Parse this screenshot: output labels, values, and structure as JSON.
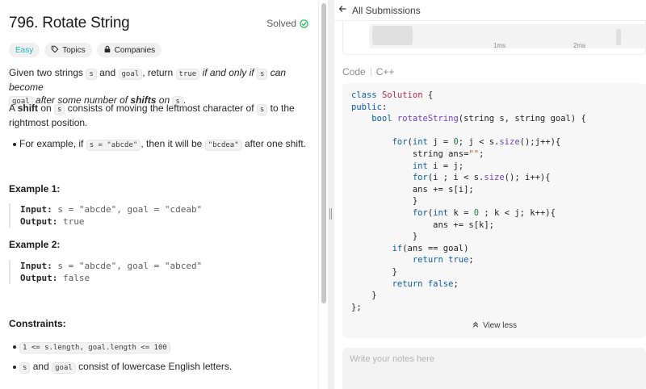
{
  "problem": {
    "title": "796. Rotate String",
    "status": "Solved",
    "badges": {
      "difficulty": "Easy",
      "topics": "Topics",
      "companies": "Companies"
    },
    "desc1": {
      "a": "Given two strings ",
      "s": "s",
      "b": " and ",
      "goal": "goal",
      "c": ", return ",
      "true": "true",
      "d": " if and only if ",
      "s2": "s",
      "e": " can become ",
      "goal2": "goal",
      "f": " after some number of ",
      "shifts": "shifts",
      "g": " on ",
      "s3": "s",
      "h": "."
    },
    "desc2": {
      "a": "A ",
      "shift": "shift",
      "b": " on ",
      "s": "s",
      "c": " consists of moving the leftmost character of ",
      "s2": "s",
      "d": " to the rightmost position."
    },
    "bullet1": {
      "a": "For example, if ",
      "code1": "s = \"abcde\"",
      "b": ", then it will be ",
      "code2": "\"bcdea\"",
      "c": " after one shift."
    },
    "example1": {
      "heading": "Example 1:",
      "input_label": "Input:",
      "input_value": "s = \"abcde\", goal = \"cdeab\"",
      "output_label": "Output:",
      "output_value": "true"
    },
    "example2": {
      "heading": "Example 2:",
      "input_label": "Input:",
      "input_value": "s = \"abcde\", goal = \"abced\"",
      "output_label": "Output:",
      "output_value": "false"
    },
    "constraints": {
      "heading": "Constraints:",
      "item1_code": "1 <= s.length, goal.length <= 100",
      "item2": {
        "s": "s",
        "a": " and ",
        "goal": "goal",
        "b": " consist of lowercase English letters."
      }
    }
  },
  "submission": {
    "back_label": "All Submissions",
    "chart_ticks": [
      "1ms",
      "2ms"
    ],
    "code_label": "Code",
    "language": "C++",
    "view_less": "View less",
    "notes_placeholder": "Write your notes here"
  },
  "icons": {
    "solved": "check-circle-icon",
    "topics": "tag-icon",
    "companies": "lock-icon",
    "back": "arrow-left-icon",
    "view_less": "chevrons-up-icon"
  },
  "colors": {
    "easy": "#1cb8b8",
    "solved": "#2cbb5d"
  }
}
